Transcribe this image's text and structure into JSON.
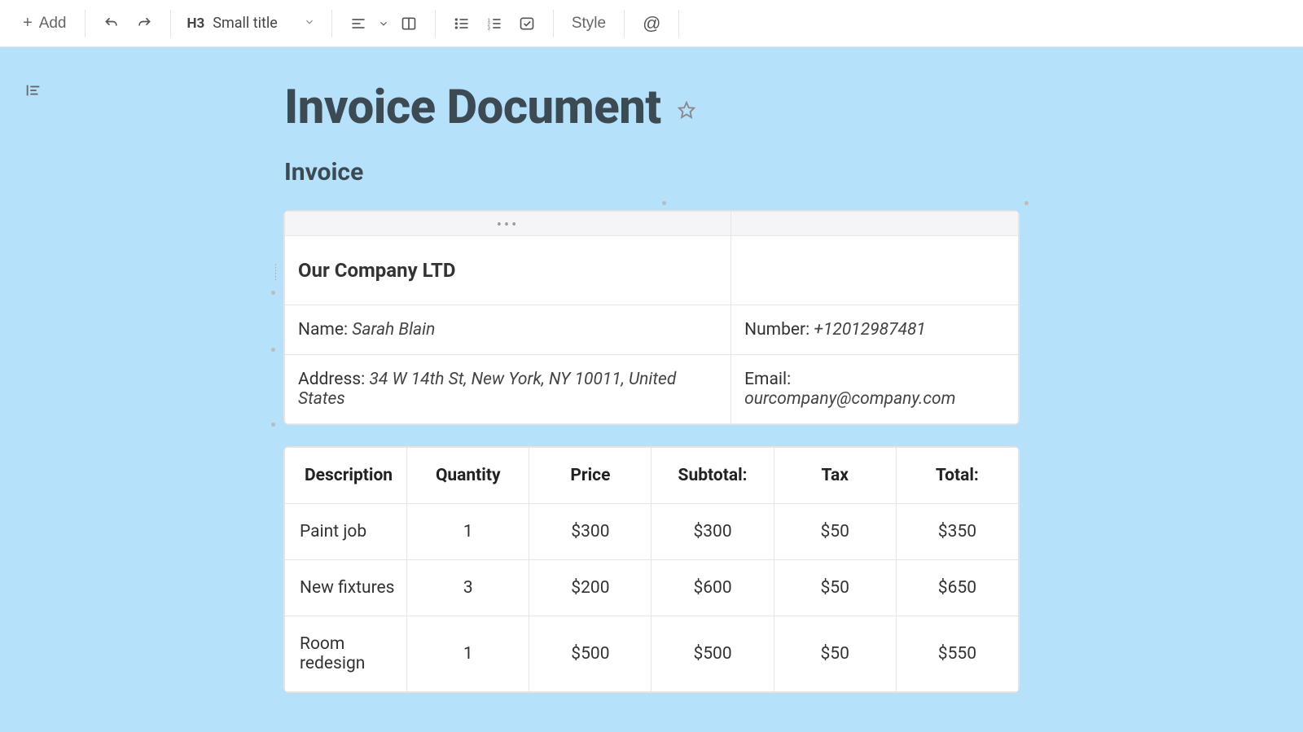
{
  "toolbar": {
    "add_label": "Add",
    "heading_prefix": "H3",
    "heading_label": "Small title",
    "style_label": "Style"
  },
  "document": {
    "title": "Invoice Document",
    "subheading": "Invoice"
  },
  "company": {
    "name": "Our Company LTD",
    "contact_name_label": "Name:",
    "contact_name": "Sarah Blain",
    "phone_label": "Number:",
    "phone": "+12012987481",
    "address_label": "Address:",
    "address": "34 W 14th St, New York, NY 10011, United States",
    "email_label": "Email:",
    "email": "ourcompany@company.com"
  },
  "items_header": {
    "description": "Description",
    "quantity": "Quantity",
    "price": "Price",
    "subtotal": "Subtotal:",
    "tax": "Tax",
    "total": "Total:"
  },
  "items": [
    {
      "description": "Paint job",
      "quantity": "1",
      "price": "$300",
      "subtotal": "$300",
      "tax": "$50",
      "total": "$350"
    },
    {
      "description": "New fixtures",
      "quantity": "3",
      "price": "$200",
      "subtotal": "$600",
      "tax": "$50",
      "total": "$650"
    },
    {
      "description": "Room redesign",
      "quantity": "1",
      "price": "$500",
      "subtotal": "$500",
      "tax": "$50",
      "total": "$550"
    }
  ]
}
